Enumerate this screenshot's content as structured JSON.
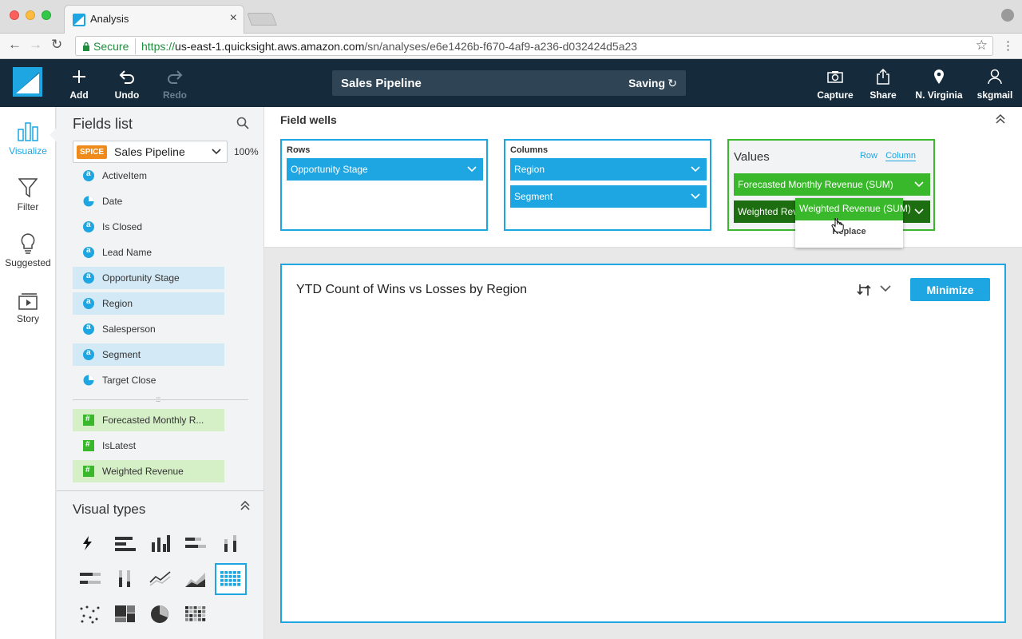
{
  "browser": {
    "tab_title": "Analysis",
    "tab_close": "×",
    "secure_label": "Secure",
    "url_scheme": "https://",
    "url_host": "us-east-1.quicksight.aws.amazon.com",
    "url_path": "/sn/analyses/e6e1426b-f670-4af9-a236-d032424d5a23"
  },
  "toolbar": {
    "add_label": "Add",
    "undo_label": "Undo",
    "redo_label": "Redo",
    "analysis_title": "Sales Pipeline",
    "saving_label": "Saving",
    "capture_label": "Capture",
    "share_label": "Share",
    "region_label": "N. Virginia",
    "user_label": "skgmail"
  },
  "leftnav": {
    "items": [
      {
        "label": "Visualize",
        "icon": "bar-chart-icon",
        "active": true
      },
      {
        "label": "Filter",
        "icon": "funnel-icon",
        "active": false
      },
      {
        "label": "Suggested",
        "icon": "lightbulb-icon",
        "active": false
      },
      {
        "label": "Story",
        "icon": "story-icon",
        "active": false
      }
    ]
  },
  "fields_panel": {
    "title": "Fields list",
    "dataset_badge": "SPICE",
    "dataset_name": "Sales Pipeline",
    "spice_percent": "100%",
    "dimensions": [
      {
        "label": "ActiveItem",
        "type": "string",
        "selected": false
      },
      {
        "label": "Date",
        "type": "date",
        "selected": false
      },
      {
        "label": "Is Closed",
        "type": "string",
        "selected": false
      },
      {
        "label": "Lead Name",
        "type": "string",
        "selected": false
      },
      {
        "label": "Opportunity Stage",
        "type": "string",
        "selected": true
      },
      {
        "label": "Region",
        "type": "string",
        "selected": true
      },
      {
        "label": "Salesperson",
        "type": "string",
        "selected": false
      },
      {
        "label": "Segment",
        "type": "string",
        "selected": true
      },
      {
        "label": "Target Close",
        "type": "date",
        "selected": false
      }
    ],
    "measures": [
      {
        "label": "Forecasted Monthly R...",
        "type": "number",
        "selected": true
      },
      {
        "label": "IsLatest",
        "type": "number",
        "selected": false
      },
      {
        "label": "Weighted Revenue",
        "type": "number",
        "selected": true
      }
    ]
  },
  "visual_types": {
    "title": "Visual types",
    "icons": [
      "autograph-icon",
      "horizontal-bar-icon",
      "vertical-bar-icon",
      "horizontal-stacked-bar-icon",
      "vertical-stacked-bar-icon",
      "horizontal-100-bar-icon",
      "vertical-100-bar-icon",
      "line-chart-icon",
      "area-chart-icon",
      "pivot-table-icon",
      "scatter-plot-icon",
      "tree-map-icon",
      "pie-chart-icon",
      "heat-map-icon"
    ],
    "active_index": 9
  },
  "field_wells": {
    "title": "Field wells",
    "rows": {
      "title": "Rows",
      "items": [
        "Opportunity Stage"
      ]
    },
    "columns": {
      "title": "Columns",
      "items": [
        "Region",
        "Segment"
      ]
    },
    "values": {
      "title": "Values",
      "row_toggle": "Row",
      "column_toggle": "Column",
      "items": [
        "Forecasted Monthly Revenue (SUM)",
        "Weighted Reve"
      ]
    },
    "drag": {
      "pill_label": "Weighted Revenue (SUM)",
      "action_label": "Replace"
    }
  },
  "visual": {
    "title": "YTD Count of Wins vs Losses by Region",
    "minimize_label": "Minimize"
  },
  "colors": {
    "brand_blue": "#1da6e2",
    "header_navy": "#152b3c",
    "measure_green": "#3ab82b",
    "spice_orange": "#ef8b1b"
  }
}
